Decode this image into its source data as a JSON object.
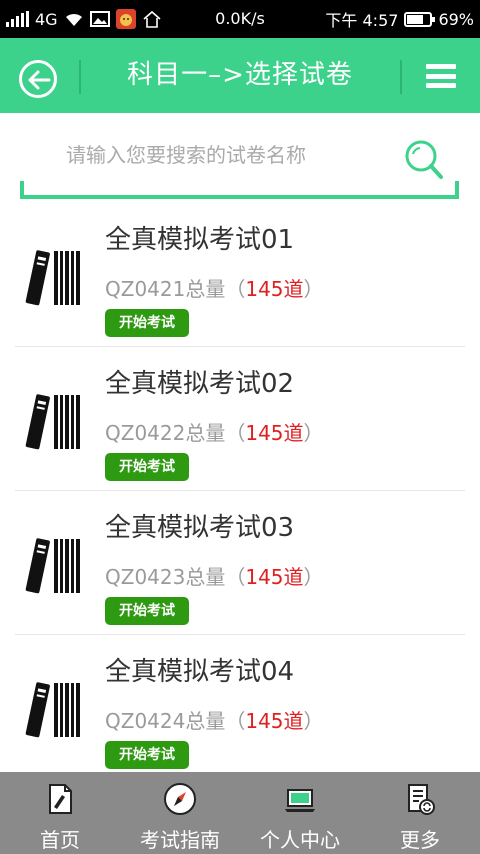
{
  "status_bar": {
    "network": "4G",
    "speed": "0.0K/s",
    "time": "下午 4:57",
    "battery": "69%",
    "battery_level": 0.69
  },
  "header": {
    "title": "科目一–>选择试卷"
  },
  "search": {
    "placeholder": "请输入您要搜索的试卷名称"
  },
  "exams": [
    {
      "title": "全真模拟考试01",
      "code": "QZ0421",
      "total_label": "总量（",
      "count": "145",
      "unit": "道",
      "close": "）",
      "button": "开始考试"
    },
    {
      "title": "全真模拟考试02",
      "code": "QZ0422",
      "total_label": "总量（",
      "count": "145",
      "unit": "道",
      "close": "）",
      "button": "开始考试"
    },
    {
      "title": "全真模拟考试03",
      "code": "QZ0423",
      "total_label": "总量（",
      "count": "145",
      "unit": "道",
      "close": "）",
      "button": "开始考试"
    },
    {
      "title": "全真模拟考试04",
      "code": "QZ0424",
      "total_label": "总量（",
      "count": "145",
      "unit": "道",
      "close": "）",
      "button": "开始考试"
    }
  ],
  "nav": [
    {
      "label": "首页",
      "icon": "home-document-icon"
    },
    {
      "label": "考试指南",
      "icon": "compass-icon"
    },
    {
      "label": "个人中心",
      "icon": "laptop-icon"
    },
    {
      "label": "更多",
      "icon": "more-document-icon"
    }
  ],
  "colors": {
    "accent": "#3dd28c",
    "button_green": "#2e9a12",
    "count_red": "#e02020",
    "nav_bg": "#8a8a8a"
  }
}
